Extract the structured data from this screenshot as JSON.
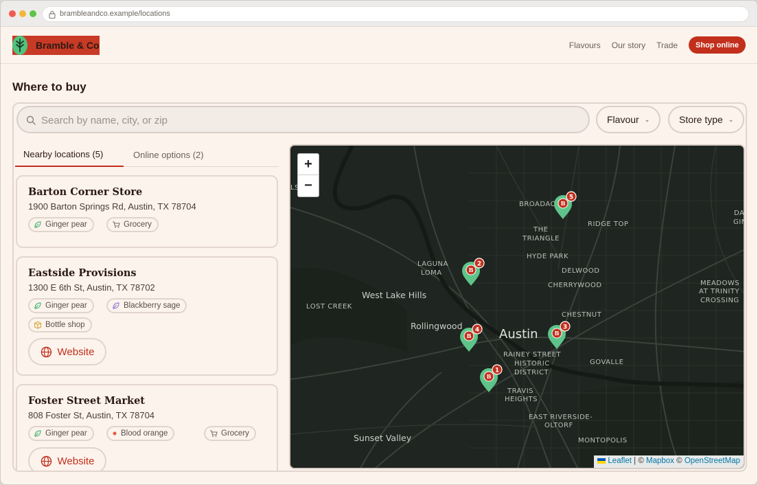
{
  "browser": {
    "url": "brambleandco.example/locations"
  },
  "header": {
    "logo_text": "Bramble & Co",
    "nav": [
      "Flavours",
      "Our story",
      "Trade"
    ],
    "shop_label": "Shop online"
  },
  "page": {
    "title": "Where to buy"
  },
  "search": {
    "placeholder": "Search by name, city, or zip"
  },
  "filters": {
    "flavour": "Flavour",
    "store_type": "Store type"
  },
  "tabs": {
    "nearby": "Nearby locations (5)",
    "online": "Online options (2)"
  },
  "locations": [
    {
      "name": "Barton Corner Store",
      "address": "1900 Barton Springs Rd, Austin, TX 78704",
      "flavours": [
        "Ginger pear"
      ],
      "type": "Grocery"
    },
    {
      "name": "Eastside Provisions",
      "address": "1300 E 6th St, Austin, TX 78702",
      "flavours": [
        "Ginger pear",
        "Blackberry sage"
      ],
      "type": "Bottle shop",
      "website_label": "Website"
    },
    {
      "name": "Foster Street Market",
      "address": "808 Foster St, Austin, TX 78704",
      "flavours": [
        "Ginger pear",
        "Blood orange"
      ],
      "type": "Grocery",
      "website_label": "Website"
    }
  ],
  "map": {
    "zoom_in": "+",
    "zoom_out": "−",
    "labels": {
      "city": "Austin",
      "west_lake_hills": "West Lake Hills",
      "rollingwood": "Rollingwood",
      "sunset_valley": "Sunset Valley",
      "lost_creek": "LOST CREEK",
      "laguna_loma_1": "LAGUNA",
      "laguna_loma_2": "LOMA",
      "broadacres": "BROADACR",
      "ridge_top": "RIDGE TOP",
      "triangle_1": "THE",
      "triangle_2": "TRIANGLE",
      "hyde_park": "HYDE PARK",
      "delwood": "DELWOOD",
      "cherrywood": "CHERRYWOOD",
      "chestnut": "CHESTNUT",
      "meadows_1": "MEADOWS",
      "meadows_2": "AT TRINITY",
      "meadows_3": "CROSSING",
      "rainey_1": "RAINEY STREET",
      "rainey_2": "HISTORIC",
      "rainey_3": "DISTRICT",
      "govalle": "GOVALLE",
      "travis_1": "TRAVIS",
      "travis_2": "HEIGHTS",
      "riverside_1": "EAST RIVERSIDE-",
      "riverside_2": "OLTORF",
      "montopolis": "MONTOPOLIS",
      "edge_ls": "LS",
      "edge_da": "DA",
      "edge_gin": "GIN"
    },
    "markers": [
      "1",
      "2",
      "3",
      "4",
      "5"
    ],
    "marker_letter": "B",
    "attribution": {
      "leaflet": "Leaflet",
      "sep1": "| ©",
      "mapbox": "Mapbox",
      "sep2": "©",
      "osm": "OpenStreetMap"
    }
  },
  "colors": {
    "brand_red": "#c22f1c",
    "brand_green": "#52c27f",
    "page_bg": "#fcf3ec",
    "map_bg": "#1f2520"
  }
}
